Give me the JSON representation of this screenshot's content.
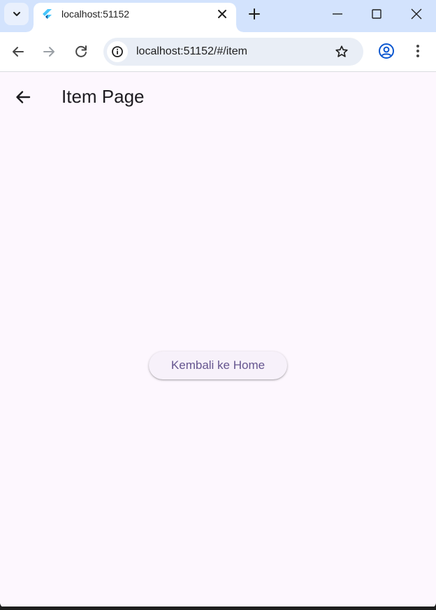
{
  "browser": {
    "tab": {
      "title": "localhost:51152"
    },
    "omnibox": {
      "url": "localhost:51152/#/item"
    }
  },
  "app": {
    "title": "Item Page",
    "home_button_label": "Kembali ke Home",
    "accent_color": "#65558f",
    "background_color": "#fdf7fe"
  }
}
